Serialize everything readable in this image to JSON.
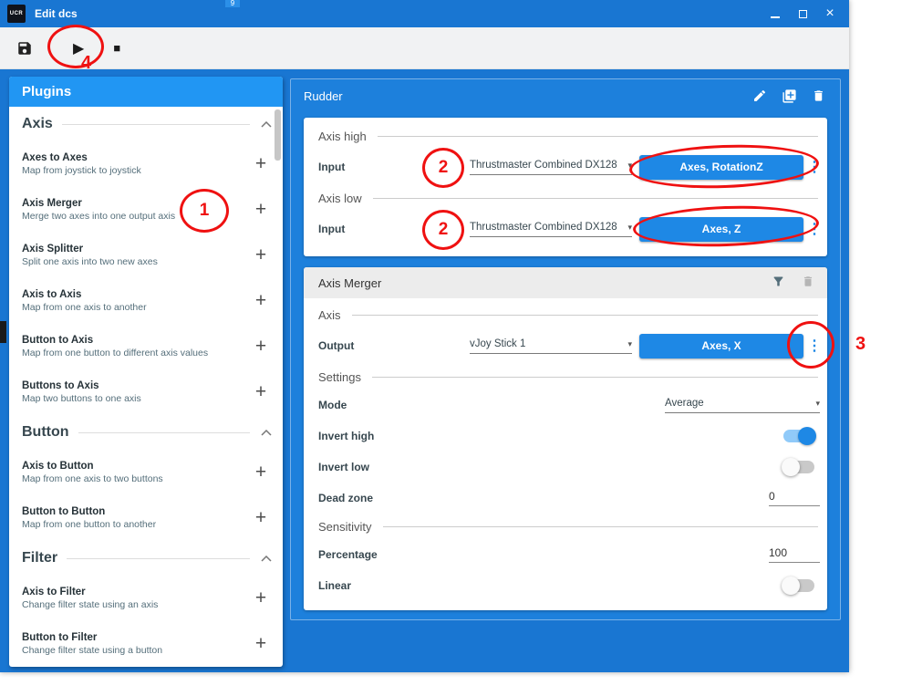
{
  "window": {
    "title": "Edit dcs",
    "app_icon_text": "UCR"
  },
  "background_fragment": "9",
  "icons": {
    "play": "▶",
    "stop": "■",
    "close": "×",
    "caret": "▾",
    "dots": "⋮",
    "plus": "+"
  },
  "plugins_panel": {
    "title": "Plugins",
    "sections": [
      {
        "name": "Axis",
        "items": [
          {
            "title": "Axes to Axes",
            "desc": "Map from joystick to joystick"
          },
          {
            "title": "Axis Merger",
            "desc": "Merge two axes into one output axis"
          },
          {
            "title": "Axis Splitter",
            "desc": "Split one axis into two new axes"
          },
          {
            "title": "Axis to Axis",
            "desc": "Map from one axis to another"
          },
          {
            "title": "Button to Axis",
            "desc": "Map from one button to different axis values"
          },
          {
            "title": "Buttons to Axis",
            "desc": "Map two buttons to one axis"
          }
        ]
      },
      {
        "name": "Button",
        "items": [
          {
            "title": "Axis to Button",
            "desc": "Map from one axis to two buttons"
          },
          {
            "title": "Button to Button",
            "desc": "Map from one button to another"
          }
        ]
      },
      {
        "name": "Filter",
        "items": [
          {
            "title": "Axis to Filter",
            "desc": "Change filter state using an axis"
          },
          {
            "title": "Button to Filter",
            "desc": "Change filter state using a button"
          }
        ]
      }
    ]
  },
  "profile": {
    "title": "Rudder",
    "groups": [
      {
        "section": "Axis high",
        "label": "Input",
        "device": "Thrustmaster Combined DX128",
        "binding": "Axes, RotationZ"
      },
      {
        "section": "Axis low",
        "label": "Input",
        "device": "Thrustmaster Combined DX128",
        "binding": "Axes, Z"
      }
    ],
    "plugin": {
      "title": "Axis Merger",
      "axis": {
        "section": "Axis",
        "label": "Output",
        "device": "vJoy Stick 1",
        "binding": "Axes, X"
      },
      "settings": {
        "section": "Settings",
        "mode": {
          "label": "Mode",
          "value": "Average"
        },
        "invert_high": {
          "label": "Invert high",
          "value": "on"
        },
        "invert_low": {
          "label": "Invert low",
          "value": "off"
        },
        "dead_zone": {
          "label": "Dead zone",
          "value": "0"
        }
      },
      "sensitivity": {
        "section": "Sensitivity",
        "percentage": {
          "label": "Percentage",
          "value": "100"
        },
        "linear": {
          "label": "Linear",
          "value": "off"
        }
      }
    }
  },
  "annotations": {
    "one": "1",
    "two": "2",
    "three": "3",
    "four": "4"
  },
  "colors": {
    "titlebar": "#1976d2",
    "panel_header": "#2196f3",
    "accent_button": "#1e88e5",
    "annotation_red": "#ef1111"
  }
}
